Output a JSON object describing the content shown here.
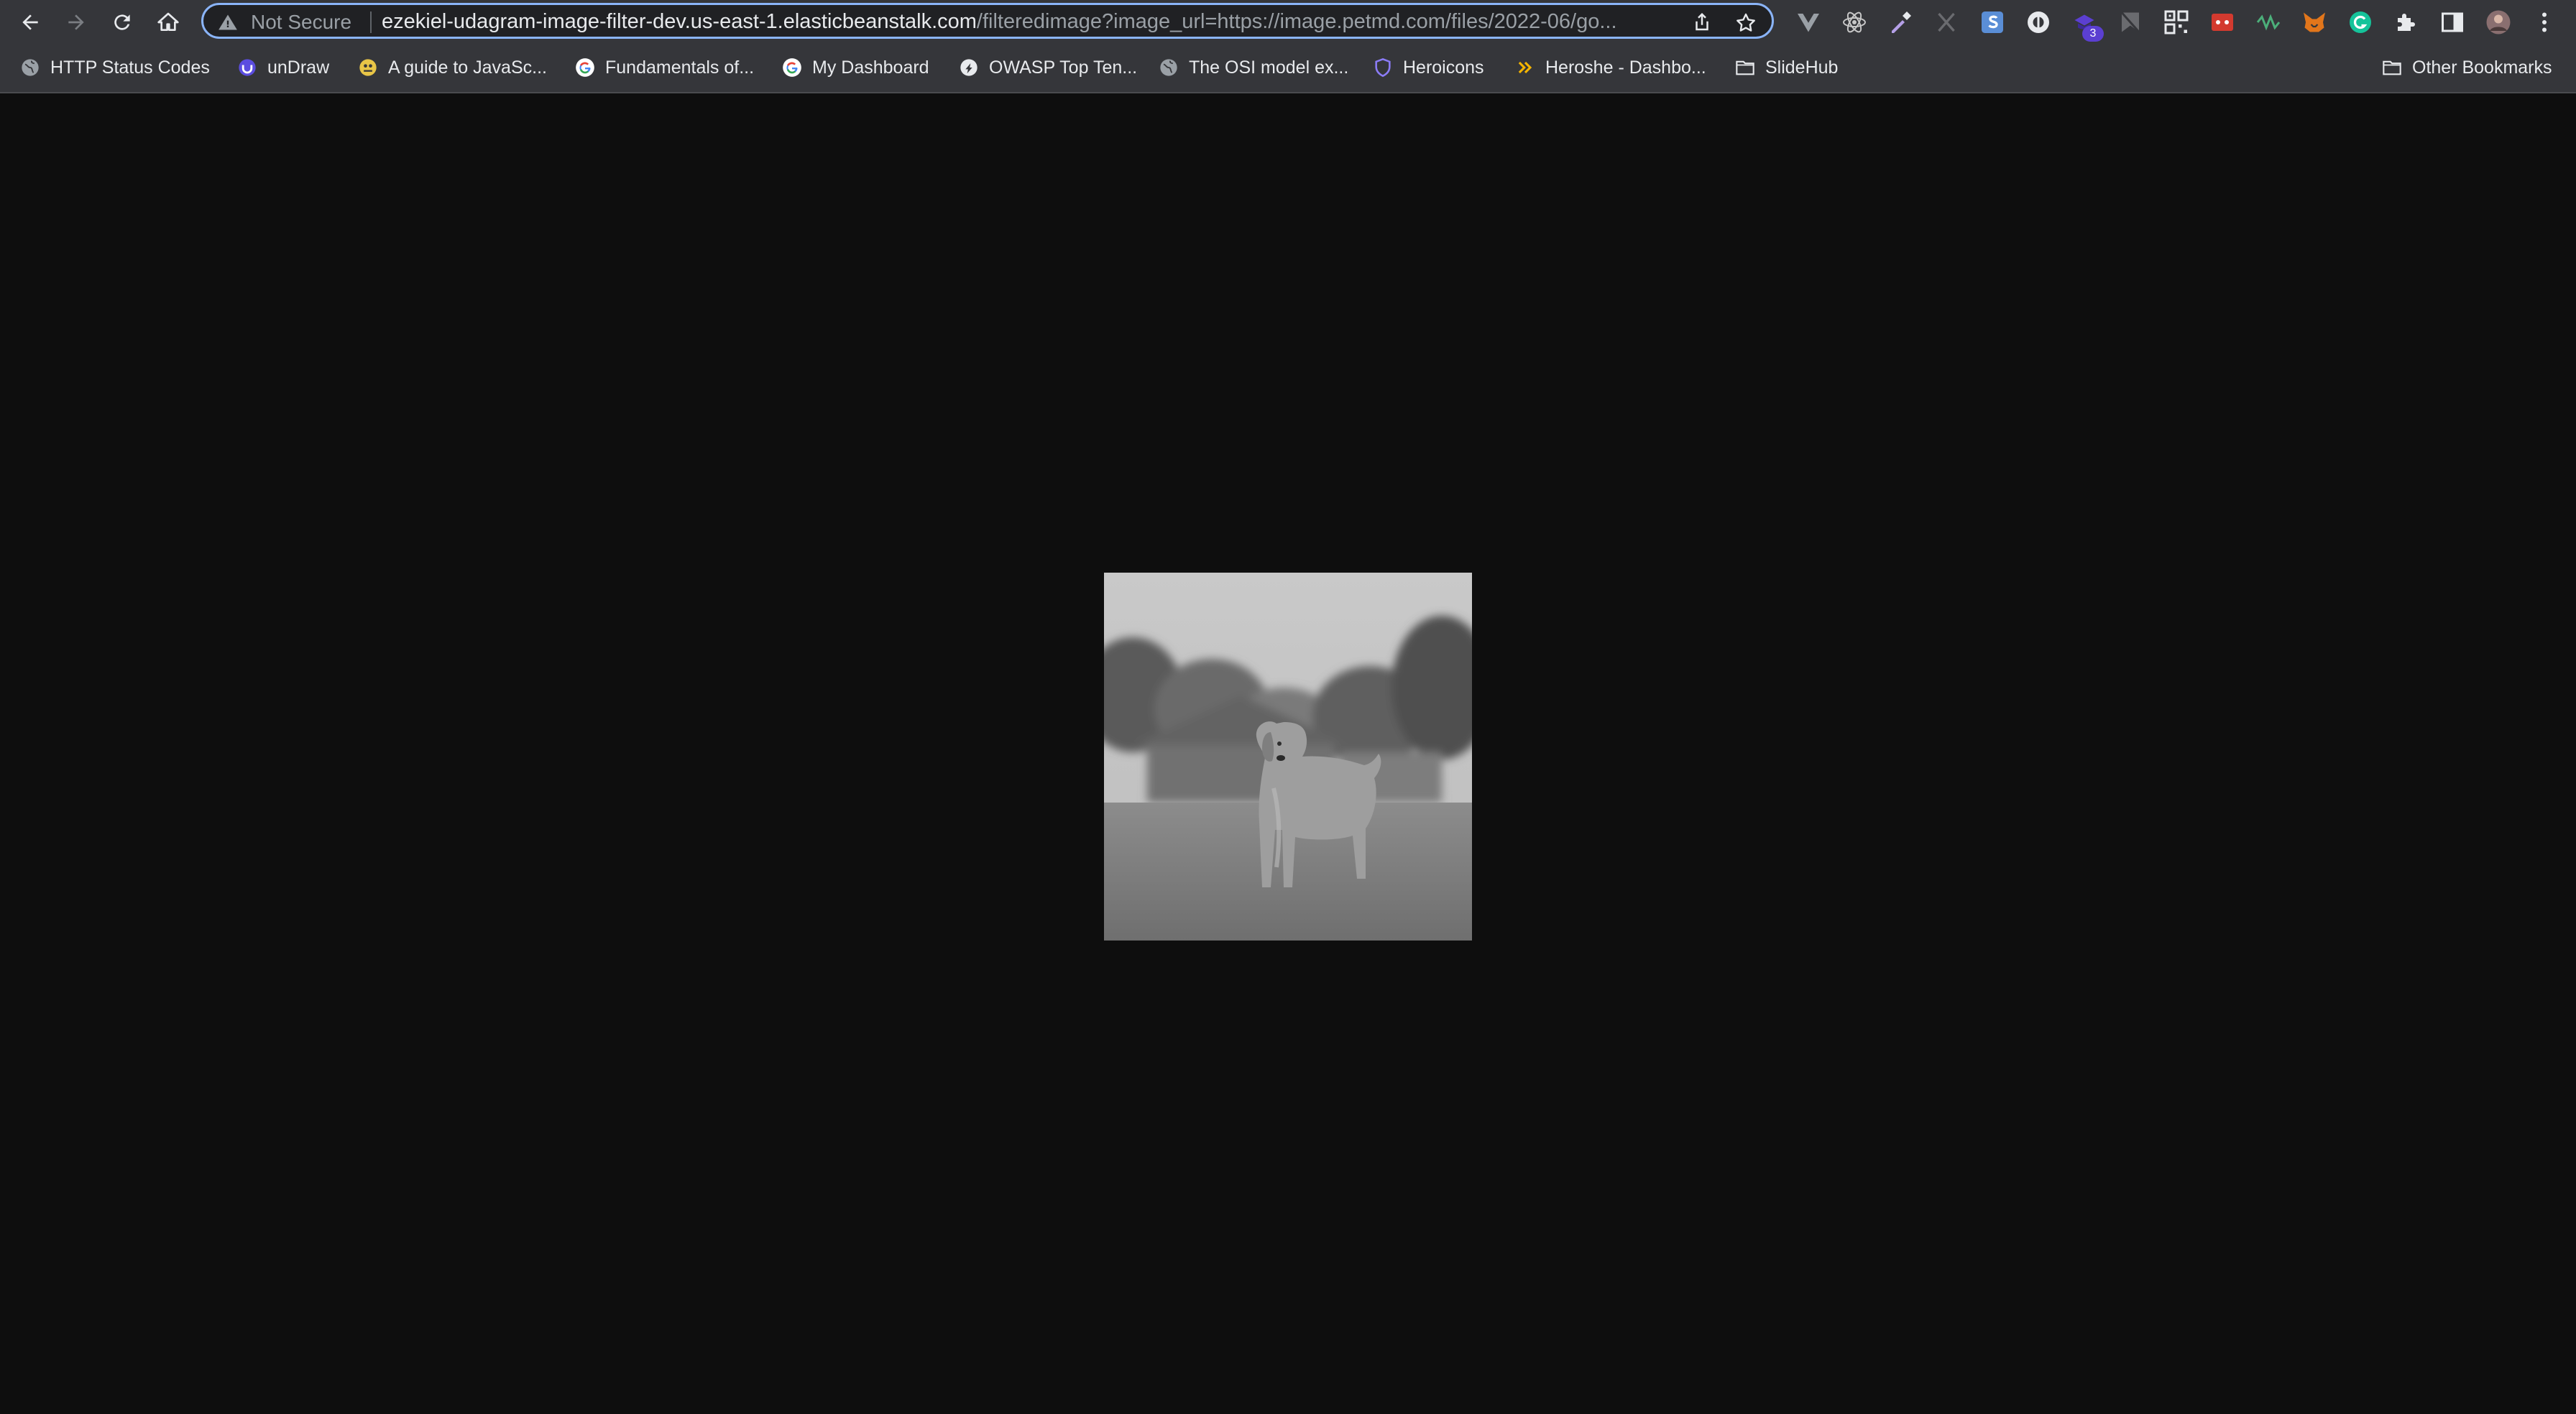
{
  "toolbar": {
    "omnibox": {
      "security_label": "Not Secure",
      "url_host": "ezekiel-udagram-image-filter-dev.us-east-1.elasticbeanstalk.com",
      "url_path": "/filteredimage?image_url=https://image.petmd.com/files/2022-06/go..."
    },
    "nav_icons": [
      "back-arrow-icon",
      "forward-arrow-icon",
      "reload-icon",
      "home-icon"
    ],
    "extensions": [
      {
        "icon": "vue-extension-icon"
      },
      {
        "icon": "react-devtools-icon"
      },
      {
        "icon": "color-picker-icon"
      },
      {
        "icon": "x-extension-icon"
      },
      {
        "icon": "s-extension-icon"
      },
      {
        "icon": "circle-extension-icon"
      },
      {
        "icon": "purple-extension-icon",
        "badge": "3"
      },
      {
        "icon": "bookmark-flag-icon"
      },
      {
        "icon": "qr-code-icon"
      },
      {
        "icon": "red-extension-icon"
      },
      {
        "icon": "wave-extension-icon"
      },
      {
        "icon": "metamask-fox-icon"
      },
      {
        "icon": "grammarly-icon"
      },
      {
        "icon": "puzzle-extensions-icon"
      },
      {
        "icon": "side-panel-icon"
      },
      {
        "icon": "profile-avatar"
      },
      {
        "icon": "menu-kebab-icon"
      }
    ]
  },
  "bookmarks": {
    "items": [
      {
        "label": "HTTP Status Codes",
        "icon": "globe-icon"
      },
      {
        "label": "unDraw",
        "icon": "undraw-icon"
      },
      {
        "label": "A guide to JavaSc...",
        "icon": "js-guide-icon"
      },
      {
        "label": "Fundamentals of...",
        "icon": "google-icon"
      },
      {
        "label": "My Dashboard",
        "icon": "google-icon"
      },
      {
        "label": "OWASP Top Ten...",
        "icon": "owasp-icon"
      },
      {
        "label": "The OSI model ex...",
        "icon": "globe-icon"
      },
      {
        "label": "Heroicons",
        "icon": "heroicons-shield-icon"
      },
      {
        "label": "Heroshe - Dashbo...",
        "icon": "heroshe-chevrons-icon"
      },
      {
        "label": "SlideHub",
        "icon": "folder-icon"
      }
    ],
    "other": {
      "label": "Other Bookmarks",
      "icon": "folder-icon"
    }
  },
  "content": {
    "image": {
      "description_icon": "grayscale-golden-retriever-photo"
    }
  },
  "colors": {
    "toolbar_bg": "#35363a",
    "omnibox_bg": "#202124",
    "focus_ring": "#8ab4f8",
    "page_bg": "#0e0e0e"
  }
}
